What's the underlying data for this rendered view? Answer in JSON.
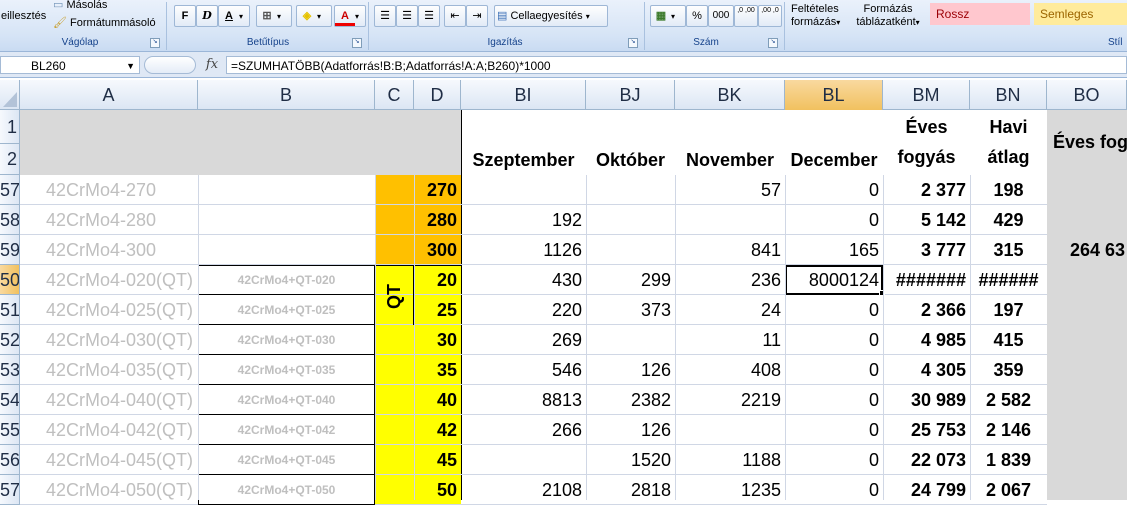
{
  "ribbon": {
    "clipboard": {
      "paste_label": "eillesztés",
      "copy_label": "Másolás",
      "format_painter_label": "Formátummásoló",
      "group_label": "Vágólap"
    },
    "font": {
      "bold": "F",
      "italic": "D",
      "underline": "A",
      "font_color_glyph": "A",
      "group_label": "Betűtípus"
    },
    "alignment": {
      "merge_label": "Cellaegyesítés",
      "group_label": "Igazítás"
    },
    "number": {
      "percent": "%",
      "thousands": "000",
      "inc_decimals": ",0 ,00",
      "dec_decimals": ",00 ,0",
      "group_label": "Szám"
    },
    "styles": {
      "conditional_label_1": "Feltételes",
      "conditional_label_2": "formázás",
      "format_table_label_1": "Formázás",
      "format_table_label_2": "táblázatként",
      "bad_label": "Rossz",
      "neutral_label": "Semleges",
      "group_label": "Stíl",
      "bad_color": "#ffc7ce",
      "neutral_color": "#ffeb9c"
    }
  },
  "formula_bar": {
    "name_box": "BL260",
    "fx": "fx",
    "formula": "=SZUMHATÖBB(Adatforrás!B:B;Adatforrás!A:A;B260)*1000"
  },
  "columns": [
    "A",
    "B",
    "C",
    "D",
    "BI",
    "BJ",
    "BK",
    "BL",
    "BM",
    "BN",
    "BO"
  ],
  "header_rows": {
    "row_numbers": [
      "1",
      "2"
    ],
    "months": [
      "Szeptember",
      "Október",
      "November",
      "December"
    ],
    "annual_1": "Éves",
    "annual_2": "fogyás",
    "monthly_1": "Havi",
    "monthly_2": "átlag",
    "annual_cons": "Éves fog"
  },
  "qt_label": "QT",
  "rows": [
    {
      "num": "57",
      "a": "42CrMo4-270",
      "b": "",
      "d": "270",
      "bi": "",
      "bj": "",
      "bk": "57",
      "bl": "0",
      "bm": "2 377",
      "bn": "198",
      "bo": ""
    },
    {
      "num": "58",
      "a": "42CrMo4-280",
      "b": "",
      "d": "280",
      "bi": "192",
      "bj": "",
      "bk": "",
      "bl": "0",
      "bm": "5 142",
      "bn": "429",
      "bo": ""
    },
    {
      "num": "59",
      "a": "42CrMo4-300",
      "b": "",
      "d": "300",
      "bi": "1126",
      "bj": "",
      "bk": "841",
      "bl": "165",
      "bm": "3 777",
      "bn": "315",
      "bo": "264 63"
    },
    {
      "num": "50",
      "a": "42CrMo4-020(QT)",
      "b": "42CrMo4+QT-020",
      "d": "20",
      "bi": "430",
      "bj": "299",
      "bk": "236",
      "bl": "8000124",
      "bm": "#######",
      "bn": "######",
      "bo": ""
    },
    {
      "num": "51",
      "a": "42CrMo4-025(QT)",
      "b": "42CrMo4+QT-025",
      "d": "25",
      "bi": "220",
      "bj": "373",
      "bk": "24",
      "bl": "0",
      "bm": "2 366",
      "bn": "197",
      "bo": ""
    },
    {
      "num": "52",
      "a": "42CrMo4-030(QT)",
      "b": "42CrMo4+QT-030",
      "d": "30",
      "bi": "269",
      "bj": "",
      "bk": "11",
      "bl": "0",
      "bm": "4 985",
      "bn": "415",
      "bo": ""
    },
    {
      "num": "53",
      "a": "42CrMo4-035(QT)",
      "b": "42CrMo4+QT-035",
      "d": "35",
      "bi": "546",
      "bj": "126",
      "bk": "408",
      "bl": "0",
      "bm": "4 305",
      "bn": "359",
      "bo": ""
    },
    {
      "num": "54",
      "a": "42CrMo4-040(QT)",
      "b": "42CrMo4+QT-040",
      "d": "40",
      "bi": "8813",
      "bj": "2382",
      "bk": "2219",
      "bl": "0",
      "bm": "30 989",
      "bn": "2 582",
      "bo": ""
    },
    {
      "num": "55",
      "a": "42CrMo4-042(QT)",
      "b": "42CrMo4+QT-042",
      "d": "42",
      "bi": "266",
      "bj": "126",
      "bk": "",
      "bl": "0",
      "bm": "25 753",
      "bn": "2 146",
      "bo": ""
    },
    {
      "num": "56",
      "a": "42CrMo4-045(QT)",
      "b": "42CrMo4+QT-045",
      "d": "45",
      "bi": "",
      "bj": "1520",
      "bk": "1188",
      "bl": "0",
      "bm": "22 073",
      "bn": "1 839",
      "bo": ""
    },
    {
      "num": "57",
      "a": "42CrMo4-050(QT)",
      "b": "42CrMo4+QT-050",
      "d": "50",
      "bi": "2108",
      "bj": "2818",
      "bk": "1235",
      "bl": "0",
      "bm": "24 799",
      "bn": "2 067",
      "bo": ""
    }
  ],
  "colors": {
    "orange": "#ffc000",
    "yellow": "#ffff00",
    "header_gray": "#d9d9d9",
    "grey_text": "#bfbfbf"
  }
}
